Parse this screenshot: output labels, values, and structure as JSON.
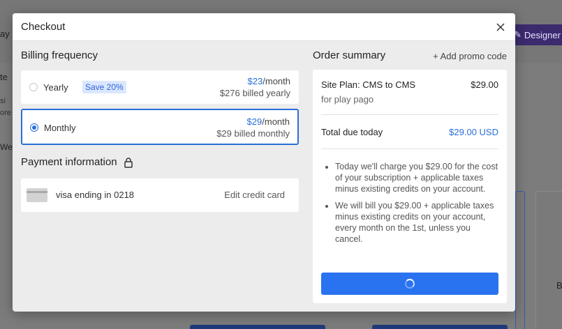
{
  "background": {
    "left_fragments": [
      "ay",
      "te",
      "si",
      "ore",
      "Web"
    ],
    "designer_label": "Designer",
    "right_fragment": "B"
  },
  "modal": {
    "title": "Checkout"
  },
  "billing": {
    "title": "Billing frequency",
    "plans": [
      {
        "label": "Yearly",
        "badge": "Save 20%",
        "price": "$23",
        "per": "/month",
        "billed": "$276 billed yearly",
        "selected": false
      },
      {
        "label": "Monthly",
        "badge": "",
        "price": "$29",
        "per": "/month",
        "billed": "$29 billed monthly",
        "selected": true
      }
    ]
  },
  "payment": {
    "title": "Payment information",
    "card_text": "visa ending in 0218",
    "edit_label": "Edit credit card"
  },
  "summary": {
    "title": "Order summary",
    "promo_label": "+ Add promo code",
    "plan_name": "Site Plan: CMS to CMS",
    "plan_price": "$29.00",
    "plan_for": "for play pago",
    "total_label": "Total due today",
    "total_amount": "$29.00 USD",
    "notes": [
      "Today we'll charge you $29.00 for the cost of your subscription + applicable taxes minus existing credits on your account.",
      "We will bill you $29.00 + applicable taxes minus existing credits on your account, every month on the 1st, unless you cancel."
    ]
  },
  "colors": {
    "accent": "#2a73f0",
    "link_blue": "#2a6ed8",
    "badge_bg": "#dbe7ff"
  }
}
